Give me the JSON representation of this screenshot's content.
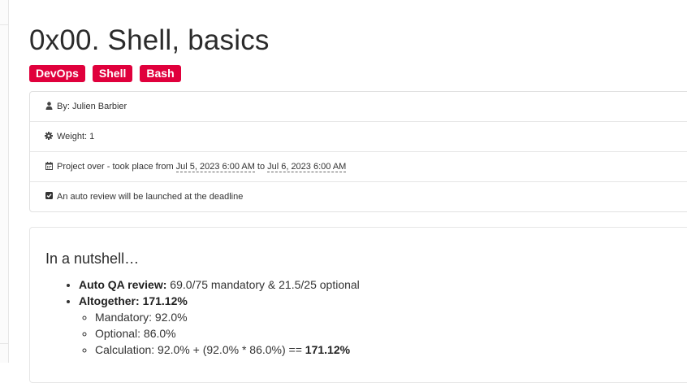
{
  "page": {
    "title": "0x00. Shell, basics",
    "tags": [
      "DevOps",
      "Shell",
      "Bash"
    ]
  },
  "meta": {
    "author": "By: Julien Barbier",
    "weight": "Weight: 1",
    "project_prefix": "Project over - took place from",
    "start_date": "Jul 5, 2023 6:00 AM",
    "to_word": "to",
    "end_date": "Jul 6, 2023 6:00 AM",
    "auto_review": "An auto review will be launched at the deadline"
  },
  "nutshell": {
    "title": "In a nutshell…",
    "qa_label": "Auto QA review:",
    "qa_value": "69.0/75 mandatory & 21.5/25 optional",
    "altogether_label": "Altogether:",
    "altogether_value": "171.12%",
    "mandatory": "Mandatory: 92.0%",
    "optional": "Optional: 86.0%",
    "calculation_prefix": "Calculation:  92.0% + (92.0% * 86.0%)  ==",
    "calculation_result": "171.12%"
  },
  "icons": {
    "author": "user-icon",
    "weight": "gear-icon",
    "project": "calendar-icon",
    "auto_review": "checkbox-icon"
  },
  "colors": {
    "tag_background": "#e0003c",
    "tag_text": "#ffffff"
  }
}
